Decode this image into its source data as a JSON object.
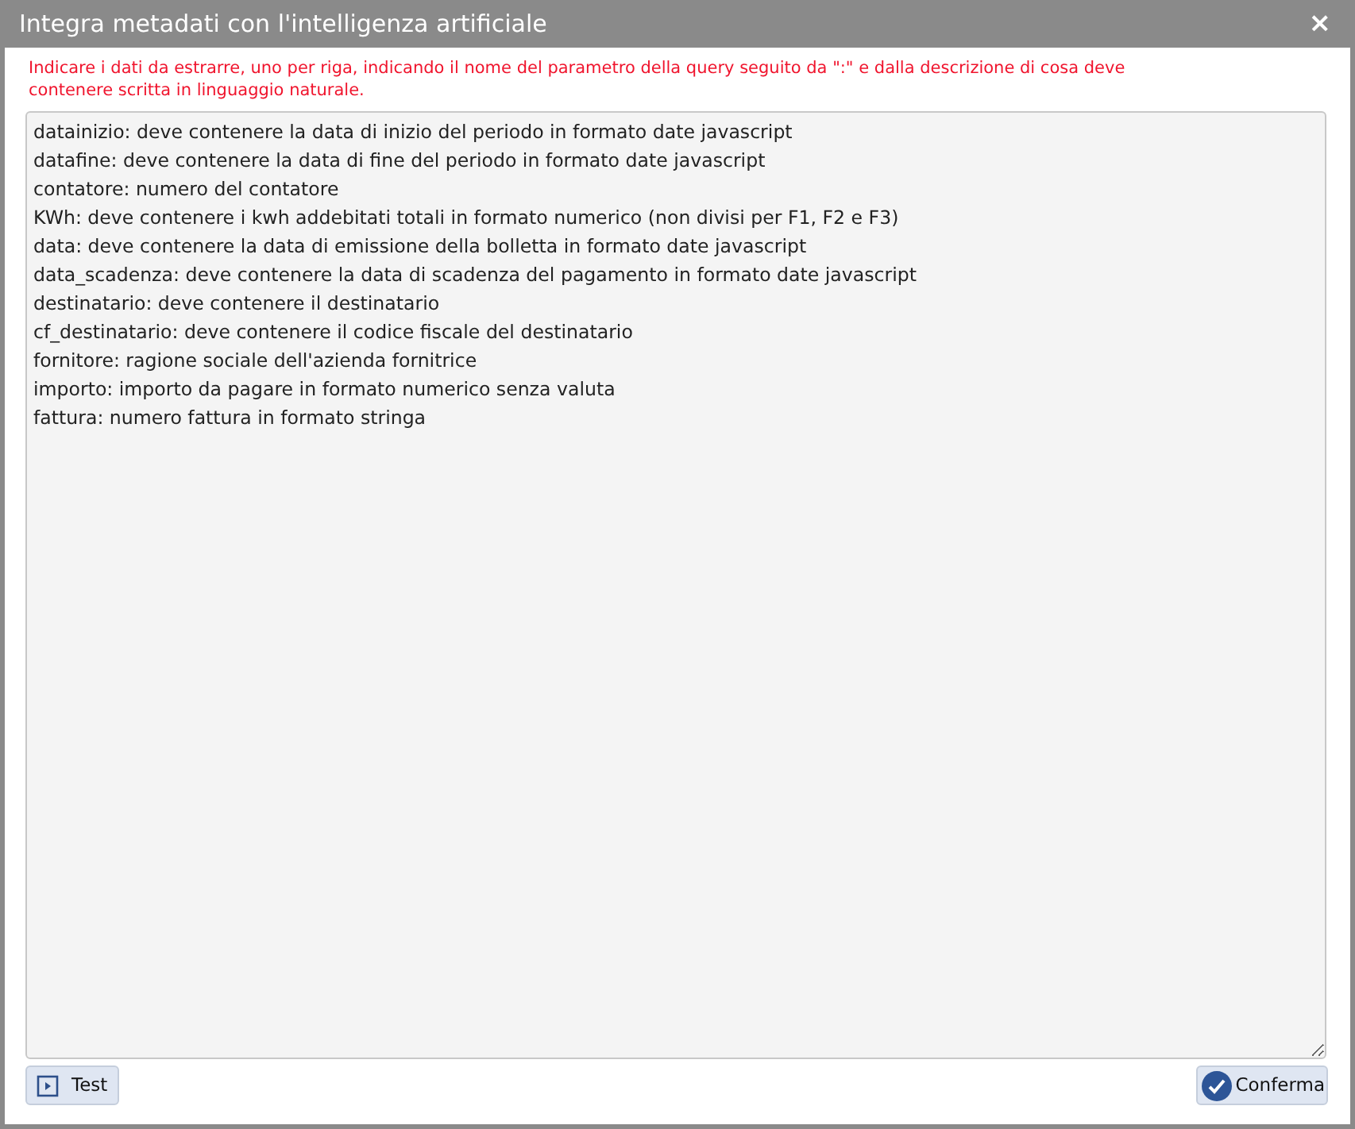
{
  "dialog": {
    "title": "Integra metadati con l'intelligenza artificiale",
    "close": "×",
    "instructions": "Indicare i dati da estrarre, uno per riga, indicando il nome del parametro della query seguito da \":\" e dalla descrizione di cosa deve contenere scritta in linguaggio naturale.",
    "lines": [
      "datainizio: deve contenere la data di inizio del periodo in formato date javascript",
      "datafine: deve contenere la data di fine del periodo in formato date javascript",
      "contatore: numero del contatore",
      "KWh: deve contenere i kwh addebitati totali in formato numerico (non divisi per F1, F2 e F3)",
      "data: deve contenere la data di emissione della bolletta in formato date javascript",
      "data_scadenza: deve contenere la data di scadenza del pagamento in formato date javascript",
      "destinatario: deve contenere il destinatario",
      "cf_destinatario: deve contenere il codice fiscale del destinatario",
      "fornitore: ragione sociale dell'azienda fornitrice",
      "importo: importo da pagare in formato numerico senza valuta",
      "fattura: numero fattura in formato stringa"
    ],
    "buttons": [
      {
        "label": "Test",
        "kind": "play"
      },
      {
        "label": "Conferma",
        "kind": "check"
      }
    ]
  }
}
